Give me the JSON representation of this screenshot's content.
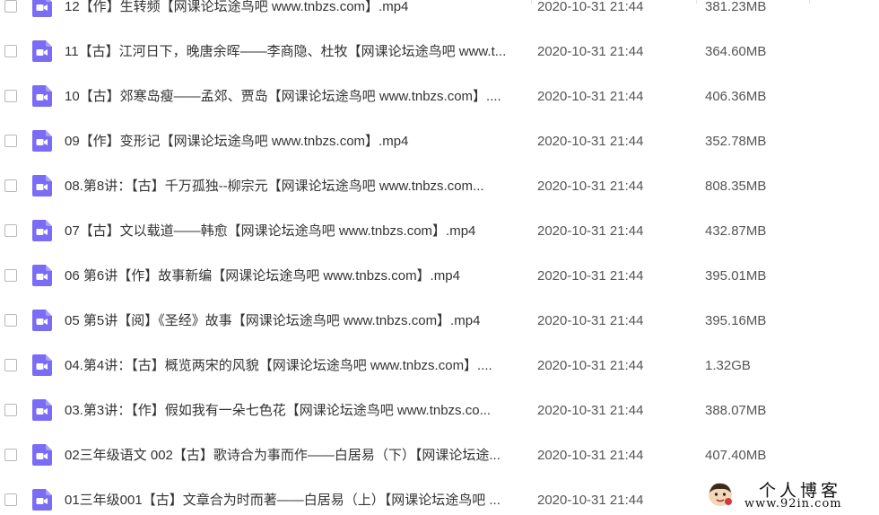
{
  "files": [
    {
      "name": "12【作】生转频【网课论坛途鸟吧 www.tnbzs.com】.mp4",
      "date": "2020-10-31 21:44",
      "size": "381.23MB",
      "icon": "video-file-icon"
    },
    {
      "name": "11【古】江河日下，晚唐余晖——李商隐、杜牧【网课论坛途鸟吧 www.t...",
      "date": "2020-10-31 21:44",
      "size": "364.60MB",
      "icon": "video-file-icon"
    },
    {
      "name": "10【古】郊寒岛瘦——孟郊、贾岛【网课论坛途鸟吧 www.tnbzs.com】....",
      "date": "2020-10-31 21:44",
      "size": "406.36MB",
      "icon": "video-file-icon"
    },
    {
      "name": "09【作】变形记【网课论坛途鸟吧 www.tnbzs.com】.mp4",
      "date": "2020-10-31 21:44",
      "size": "352.78MB",
      "icon": "video-file-icon"
    },
    {
      "name": "08.第8讲：【古】千万孤独--柳宗元【网课论坛途鸟吧 www.tnbzs.com...",
      "date": "2020-10-31 21:44",
      "size": "808.35MB",
      "icon": "video-file-icon"
    },
    {
      "name": "07【古】文以载道——韩愈【网课论坛途鸟吧 www.tnbzs.com】.mp4",
      "date": "2020-10-31 21:44",
      "size": "432.87MB",
      "icon": "video-file-icon"
    },
    {
      "name": "06 第6讲【作】故事新编【网课论坛途鸟吧 www.tnbzs.com】.mp4",
      "date": "2020-10-31 21:44",
      "size": "395.01MB",
      "icon": "video-file-icon"
    },
    {
      "name": "05 第5讲【阅】《圣经》故事【网课论坛途鸟吧 www.tnbzs.com】.mp4",
      "date": "2020-10-31 21:44",
      "size": "395.16MB",
      "icon": "video-file-icon"
    },
    {
      "name": "04.第4讲：【古】概览两宋的风貌【网课论坛途鸟吧 www.tnbzs.com】....",
      "date": "2020-10-31 21:44",
      "size": "1.32GB",
      "icon": "video-file-icon"
    },
    {
      "name": "03.第3讲：【作】假如我有一朵七色花【网课论坛途鸟吧 www.tnbzs.co...",
      "date": "2020-10-31 21:44",
      "size": "388.07MB",
      "icon": "video-file-icon"
    },
    {
      "name": "02三年级语文 002【古】歌诗合为事而作——白居易（下）【网课论坛途...",
      "date": "2020-10-31 21:44",
      "size": "407.40MB",
      "icon": "video-file-icon"
    },
    {
      "name": "01三年级001【古】文章合为时而著——白居易（上）【网课论坛途鸟吧 ...",
      "date": "2020-10-31 21:44",
      "size": "",
      "icon": "video-file-icon"
    }
  ],
  "watermark": {
    "title": "个人博客",
    "url": "www.92in.com"
  },
  "colors": {
    "icon_purple": "#7b6cf6",
    "checkbox_border": "#b8b8b8",
    "text": "#333333"
  }
}
